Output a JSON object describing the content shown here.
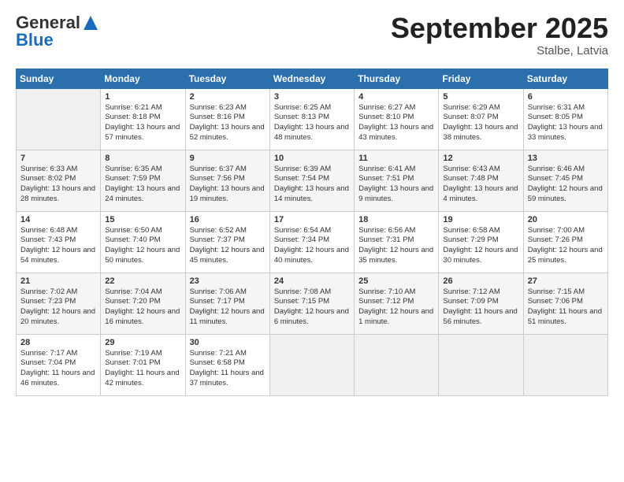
{
  "header": {
    "logo_line1": "General",
    "logo_line2": "Blue",
    "month": "September 2025",
    "location": "Stalbe, Latvia"
  },
  "weekdays": [
    "Sunday",
    "Monday",
    "Tuesday",
    "Wednesday",
    "Thursday",
    "Friday",
    "Saturday"
  ],
  "weeks": [
    [
      null,
      {
        "day": 1,
        "sunrise": "6:21 AM",
        "sunset": "8:18 PM",
        "daylight": "13 hours and 57 minutes."
      },
      {
        "day": 2,
        "sunrise": "6:23 AM",
        "sunset": "8:16 PM",
        "daylight": "13 hours and 52 minutes."
      },
      {
        "day": 3,
        "sunrise": "6:25 AM",
        "sunset": "8:13 PM",
        "daylight": "13 hours and 48 minutes."
      },
      {
        "day": 4,
        "sunrise": "6:27 AM",
        "sunset": "8:10 PM",
        "daylight": "13 hours and 43 minutes."
      },
      {
        "day": 5,
        "sunrise": "6:29 AM",
        "sunset": "8:07 PM",
        "daylight": "13 hours and 38 minutes."
      },
      {
        "day": 6,
        "sunrise": "6:31 AM",
        "sunset": "8:05 PM",
        "daylight": "13 hours and 33 minutes."
      }
    ],
    [
      {
        "day": 7,
        "sunrise": "6:33 AM",
        "sunset": "8:02 PM",
        "daylight": "13 hours and 28 minutes."
      },
      {
        "day": 8,
        "sunrise": "6:35 AM",
        "sunset": "7:59 PM",
        "daylight": "13 hours and 24 minutes."
      },
      {
        "day": 9,
        "sunrise": "6:37 AM",
        "sunset": "7:56 PM",
        "daylight": "13 hours and 19 minutes."
      },
      {
        "day": 10,
        "sunrise": "6:39 AM",
        "sunset": "7:54 PM",
        "daylight": "13 hours and 14 minutes."
      },
      {
        "day": 11,
        "sunrise": "6:41 AM",
        "sunset": "7:51 PM",
        "daylight": "13 hours and 9 minutes."
      },
      {
        "day": 12,
        "sunrise": "6:43 AM",
        "sunset": "7:48 PM",
        "daylight": "13 hours and 4 minutes."
      },
      {
        "day": 13,
        "sunrise": "6:46 AM",
        "sunset": "7:45 PM",
        "daylight": "12 hours and 59 minutes."
      }
    ],
    [
      {
        "day": 14,
        "sunrise": "6:48 AM",
        "sunset": "7:43 PM",
        "daylight": "12 hours and 54 minutes."
      },
      {
        "day": 15,
        "sunrise": "6:50 AM",
        "sunset": "7:40 PM",
        "daylight": "12 hours and 50 minutes."
      },
      {
        "day": 16,
        "sunrise": "6:52 AM",
        "sunset": "7:37 PM",
        "daylight": "12 hours and 45 minutes."
      },
      {
        "day": 17,
        "sunrise": "6:54 AM",
        "sunset": "7:34 PM",
        "daylight": "12 hours and 40 minutes."
      },
      {
        "day": 18,
        "sunrise": "6:56 AM",
        "sunset": "7:31 PM",
        "daylight": "12 hours and 35 minutes."
      },
      {
        "day": 19,
        "sunrise": "6:58 AM",
        "sunset": "7:29 PM",
        "daylight": "12 hours and 30 minutes."
      },
      {
        "day": 20,
        "sunrise": "7:00 AM",
        "sunset": "7:26 PM",
        "daylight": "12 hours and 25 minutes."
      }
    ],
    [
      {
        "day": 21,
        "sunrise": "7:02 AM",
        "sunset": "7:23 PM",
        "daylight": "12 hours and 20 minutes."
      },
      {
        "day": 22,
        "sunrise": "7:04 AM",
        "sunset": "7:20 PM",
        "daylight": "12 hours and 16 minutes."
      },
      {
        "day": 23,
        "sunrise": "7:06 AM",
        "sunset": "7:17 PM",
        "daylight": "12 hours and 11 minutes."
      },
      {
        "day": 24,
        "sunrise": "7:08 AM",
        "sunset": "7:15 PM",
        "daylight": "12 hours and 6 minutes."
      },
      {
        "day": 25,
        "sunrise": "7:10 AM",
        "sunset": "7:12 PM",
        "daylight": "12 hours and 1 minute."
      },
      {
        "day": 26,
        "sunrise": "7:12 AM",
        "sunset": "7:09 PM",
        "daylight": "11 hours and 56 minutes."
      },
      {
        "day": 27,
        "sunrise": "7:15 AM",
        "sunset": "7:06 PM",
        "daylight": "11 hours and 51 minutes."
      }
    ],
    [
      {
        "day": 28,
        "sunrise": "7:17 AM",
        "sunset": "7:04 PM",
        "daylight": "11 hours and 46 minutes."
      },
      {
        "day": 29,
        "sunrise": "7:19 AM",
        "sunset": "7:01 PM",
        "daylight": "11 hours and 42 minutes."
      },
      {
        "day": 30,
        "sunrise": "7:21 AM",
        "sunset": "6:58 PM",
        "daylight": "11 hours and 37 minutes."
      },
      null,
      null,
      null,
      null
    ]
  ]
}
